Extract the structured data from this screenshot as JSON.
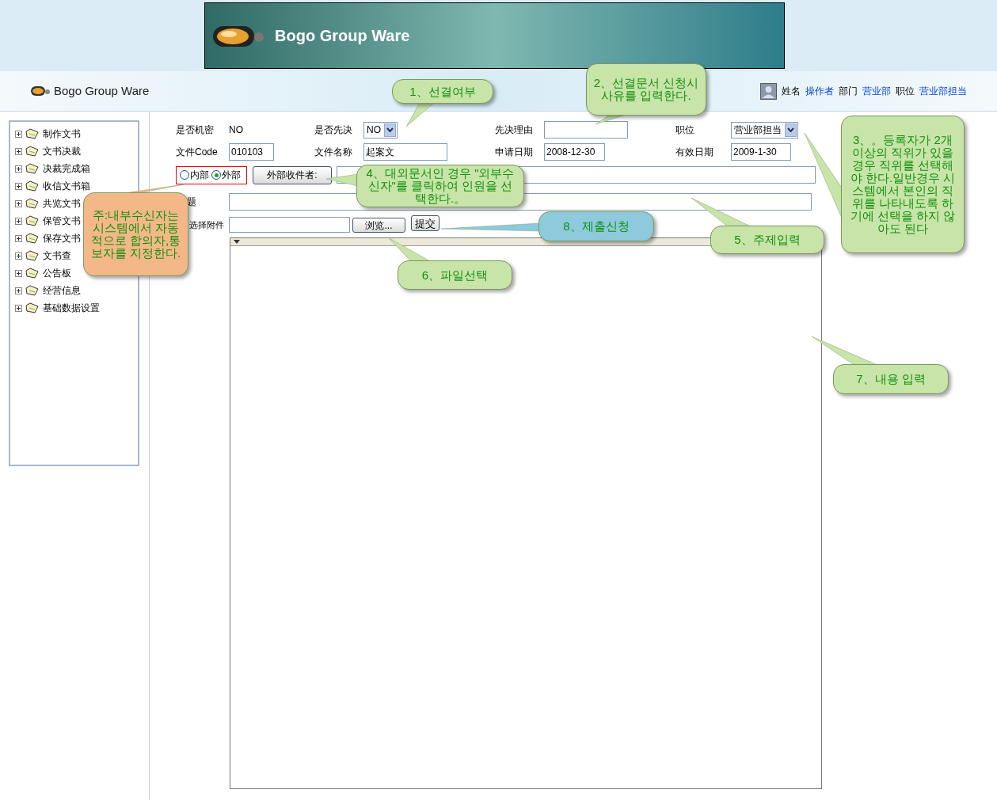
{
  "banner": {
    "title": "Bogo Group Ware"
  },
  "header": {
    "app_name": "Bogo Group Ware",
    "user_info": [
      {
        "label": "姓名",
        "value": "操作者"
      },
      {
        "label": "部门",
        "value": "营业部"
      },
      {
        "label": "职位",
        "value": "营业部担当"
      }
    ]
  },
  "sidebar": {
    "items": [
      {
        "label": "制作文书"
      },
      {
        "label": "文书决裁"
      },
      {
        "label": "决裁完成箱"
      },
      {
        "label": "收信文书箱"
      },
      {
        "label": "共览文书"
      },
      {
        "label": "保管文书"
      },
      {
        "label": "保存文书"
      },
      {
        "label": "文书查"
      },
      {
        "label": "公告板"
      },
      {
        "label": "经营信息"
      },
      {
        "label": "基础数据设置"
      }
    ]
  },
  "form": {
    "rows": [
      [
        {
          "label": "是否机密",
          "kind": "text",
          "value": "NO"
        },
        {
          "label": "是否先决",
          "kind": "select",
          "value": "NO"
        },
        {
          "label": "先决理由",
          "kind": "input"
        },
        {
          "label": "职位",
          "kind": "select",
          "value": "营业部担当"
        }
      ],
      [
        {
          "label": "文件Code",
          "kind": "input",
          "value": "010103"
        },
        {
          "label": "文件名称",
          "kind": "input",
          "value": "起案文"
        },
        {
          "label": "申请日期",
          "kind": "input",
          "value": "2008-12-30"
        },
        {
          "label": "有效日期",
          "kind": "input",
          "value": "2009-1-30"
        }
      ]
    ],
    "recipient_type": [
      {
        "label": "内部",
        "selected": false
      },
      {
        "label": "外部",
        "selected": true
      }
    ],
    "recipient_button": "外部收件者:",
    "subject_label": "题",
    "attachment_label": "选择附件",
    "browse_button": "浏览...",
    "submit_button": "提交"
  },
  "callouts": [
    {
      "text": "1、선결여부",
      "color": "#c8e4a8"
    },
    {
      "text": "2、선결문서 신청시 사유를 입력한다.",
      "color": "#c8e4a8"
    },
    {
      "text": "주:내부수신자는 시스템에서 자동적으로 합의자,통보자를 지정한다.",
      "color": "#f4b888"
    },
    {
      "text": "4、대외문서인 경우 \"외부수신자\"를 클릭하여 인원을 선택한다.。",
      "color": "#c8e4a8"
    },
    {
      "text": "8、제출신청",
      "color": "#8ccadc"
    },
    {
      "text": "5、주제입력",
      "color": "#c8e4a8"
    },
    {
      "text": "3、。등록자가 2개이상의 직위가 있을 경우 직위를 선택해야 한다.일반경우 시스템에서 본인의 직위를 나타내도록 하기에 선택을 하지 않아도 된다",
      "color": "#c8e4a8"
    },
    {
      "text": "6、파일선택",
      "color": "#c8e4a8"
    },
    {
      "text": "7、내용 입력",
      "color": "#c8e4a8"
    }
  ]
}
